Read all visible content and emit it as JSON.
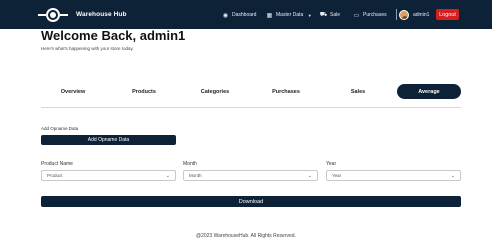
{
  "navbar": {
    "brand": "Warehouse Hub",
    "items": [
      {
        "label": "Dashboard",
        "icon": "dashboard-icon"
      },
      {
        "label": "Master Data",
        "icon": "master-data-icon"
      },
      {
        "label": "Sale",
        "icon": "cart-icon"
      },
      {
        "label": "Purchases",
        "icon": "purchases-icon"
      }
    ],
    "username": "admin1",
    "logout_label": "Logout"
  },
  "header": {
    "title": "Welcome Back, admin1",
    "subtitle": "Here's what's happening with your store today."
  },
  "tabs": [
    {
      "label": "Overview",
      "active": false
    },
    {
      "label": "Products",
      "active": false
    },
    {
      "label": "Categories",
      "active": false
    },
    {
      "label": "Purchases",
      "active": false
    },
    {
      "label": "Sales",
      "active": false
    },
    {
      "label": "Average",
      "active": true
    }
  ],
  "opname": {
    "section_label": "Add Opname Data",
    "button_label": "Add Opname Data"
  },
  "filters": {
    "product": {
      "label": "Product Name",
      "value": "Product"
    },
    "month": {
      "label": "Month",
      "value": "Month"
    },
    "year": {
      "label": "Year",
      "value": "Year"
    }
  },
  "download_label": "Download",
  "footer": "@2023 WarehouseHub. All Rights Reserved.",
  "colors": {
    "navy": "#0d2137",
    "logout_red": "#d62020"
  }
}
